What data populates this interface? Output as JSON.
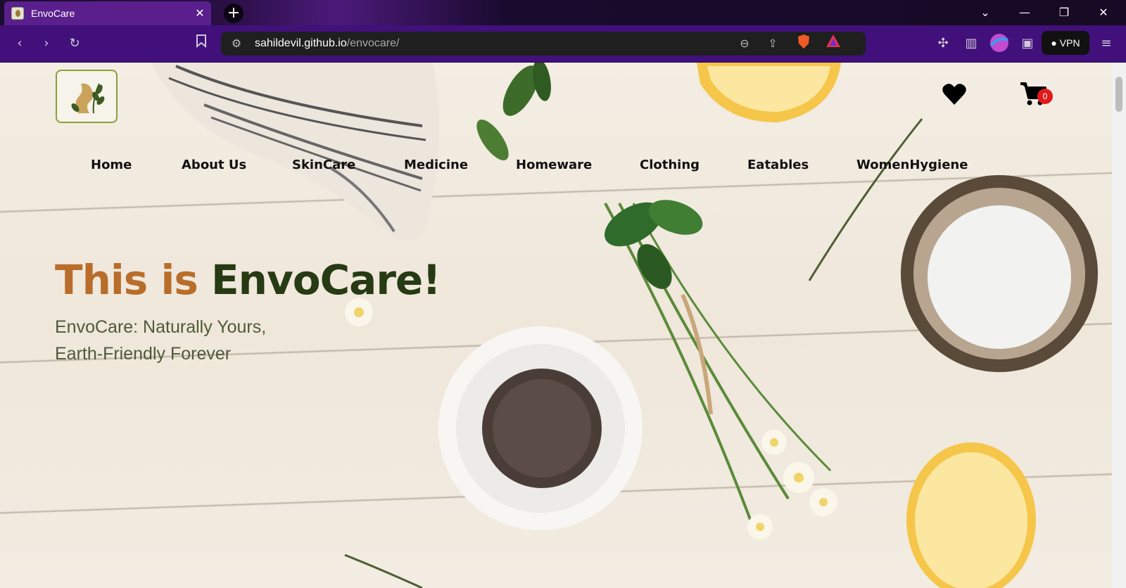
{
  "browser": {
    "tab_title": "EnvoCare",
    "url_host": "sahildevil.github.io",
    "url_path": "/envocare/",
    "vpn_label": "VPN",
    "accent": "#41107a"
  },
  "site": {
    "nav": [
      "Home",
      "About Us",
      "SkinCare",
      "Medicine",
      "Homeware",
      "Clothing",
      "Eatables",
      "WomenHygiene"
    ],
    "cart_count": "0",
    "hero_title_part1": "This is ",
    "hero_title_part2": "EnvoCare!",
    "hero_subtitle_line1": "EnvoCare: Naturally Yours,",
    "hero_subtitle_line2": "Earth-Friendly Forever",
    "colors": {
      "title_orange": "#b86d2b",
      "title_green": "#263a14",
      "badge": "#e01a1a"
    }
  }
}
